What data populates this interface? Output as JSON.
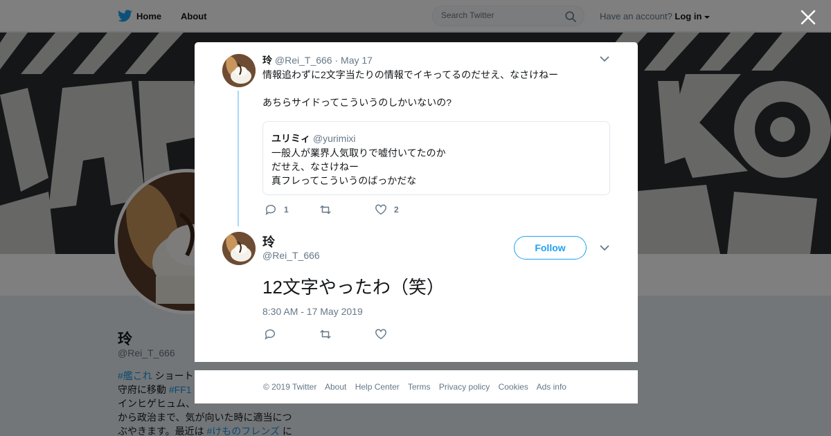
{
  "nav": {
    "home_label": "Home",
    "about_label": "About",
    "search_placeholder": "Search Twitter",
    "account_prompt": "Have an account?",
    "login_label": "Log in"
  },
  "profile": {
    "name": "玲",
    "handle": "@Rei_T_666",
    "bio_tag1": "#艦これ",
    "bio_text1": " ショート",
    "bio_text2": "守府に移動 ",
    "bio_tag2": "#FF1",
    "bio_text3": "インヒゲヒュム、",
    "bio_text4": "から政治まで、気が向いた時に適当につ",
    "bio_text5": "ぶやきます。最近は ",
    "bio_tag3": "#けものフレンズ",
    "bio_text6": " に"
  },
  "tweet_parent": {
    "author_name": "玲",
    "author_handle": "@Rei_T_666",
    "separator": "·",
    "date": "May 17",
    "text_line1": "情報追わずに2文字当たりの情報でイキってるのだせえ、なさけねー",
    "text_line2": "あちらサイドってこういうのしかいないの?",
    "quote": {
      "author_name": "ユリミィ",
      "author_handle": "@yurimixi",
      "line1": "一般人が業界人気取りで嘘付いてたのか",
      "line2": "だせえ、なさけねー",
      "line3": "真フレってこういうのばっかだな"
    },
    "reply_count": "1",
    "like_count": "2"
  },
  "tweet_main": {
    "author_name": "玲",
    "author_handle": "@Rei_T_666",
    "follow_label": "Follow",
    "text": "12文字やったわ（笑）",
    "timestamp": "8:30 AM - 17 May 2019"
  },
  "footer": {
    "copyright": "© 2019 Twitter",
    "about": "About",
    "help": "Help Center",
    "terms": "Terms",
    "privacy": "Privacy policy",
    "cookies": "Cookies",
    "ads": "Ads info"
  },
  "colors": {
    "brand": "#1da1f2",
    "thread_line": "#a4d9f9",
    "muted_text": "#657786",
    "hashtag": "#1b95e0"
  }
}
